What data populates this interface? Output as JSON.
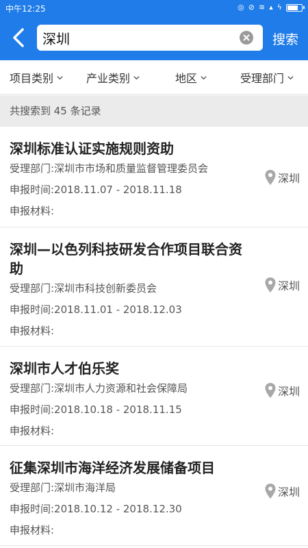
{
  "status_bar": {
    "time": "中午12:25"
  },
  "search": {
    "query": "深圳",
    "button_label": "搜索"
  },
  "filters": [
    {
      "label": "项目类别"
    },
    {
      "label": "产业类别"
    },
    {
      "label": "地区"
    },
    {
      "label": "受理部门"
    }
  ],
  "results_count": "共搜索到 45 条记录",
  "results": [
    {
      "title": "深圳标准认证实施规则资助",
      "dept": "受理部门:深圳市市场和质量监督管理委员会",
      "time": "申报时间:2018.11.07  -   2018.11.18",
      "materials": "申报材料:",
      "region": "深圳"
    },
    {
      "title": "深圳—以色列科技研发合作项目联合资助",
      "dept": "受理部门:深圳市科技创新委员会",
      "time": "申报时间:2018.11.01  -   2018.12.03",
      "materials": "申报材料:",
      "region": "深圳"
    },
    {
      "title": "深圳市人才伯乐奖",
      "dept": "受理部门:深圳市人力资源和社会保障局",
      "time": "申报时间:2018.10.18  -   2018.11.15",
      "materials": "申报材料:",
      "region": "深圳"
    },
    {
      "title": "征集深圳市海洋经济发展储备项目",
      "dept": "受理部门:深圳市海洋局",
      "time": "申报时间:2018.10.12  -   2018.12.30",
      "materials": "申报材料:",
      "region": "深圳"
    }
  ],
  "colors": {
    "primary": "#1f7ce8",
    "count_bar_bg": "#ebebeb",
    "pin": "#a8a8a8"
  },
  "icons": [
    "back-arrow-icon",
    "clear-icon",
    "chevron-down-icon",
    "location-pin-icon"
  ]
}
